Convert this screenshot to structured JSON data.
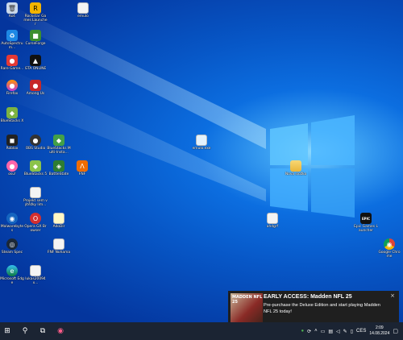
{
  "desktop_icons": [
    {
      "label": "Koš",
      "glyph": "🗑"
    },
    {
      "label": "Rockstar Games Launcher",
      "glyph": "R"
    },
    {
      "label": "emulo",
      "glyph": ""
    },
    {
      "label": "AutoSpectrum...",
      "glyph": "♻"
    },
    {
      "label": "CurseForge",
      "glyph": "■"
    },
    {
      "label": "Rare Game...",
      "glyph": "●"
    },
    {
      "label": "GTA ONLINE",
      "glyph": "▲"
    },
    {
      "label": "Firefox",
      "glyph": "●"
    },
    {
      "label": "Among Us",
      "glyph": "●"
    },
    {
      "label": "BlueStacks X",
      "glyph": "◆"
    },
    {
      "label": "Roblox",
      "glyph": "◼"
    },
    {
      "label": "OBS Studio",
      "glyph": "●"
    },
    {
      "label": "BlueStacks Multi-Insta...",
      "glyph": "◆"
    },
    {
      "label": "emulo.exe",
      "glyph": ""
    },
    {
      "label": "Nová složka",
      "glyph": ""
    },
    {
      "label": "osu!",
      "glyph": "●"
    },
    {
      "label": "BlueStacks 5",
      "glyph": "◆"
    },
    {
      "label": "BattleState",
      "glyph": "◈"
    },
    {
      "label": "FNF",
      "glyph": "Λ"
    },
    {
      "label": "Projekt sem výtěžky lim...",
      "glyph": ""
    },
    {
      "label": "Malwarebytes",
      "glyph": "◉"
    },
    {
      "label": "Opera GX Browser",
      "glyph": "O"
    },
    {
      "label": "AdoDir",
      "glyph": ""
    },
    {
      "label": "ahdgrf",
      "glyph": ""
    },
    {
      "label": "Epic Games Launcher",
      "glyph": "EPIC"
    },
    {
      "label": "Steam Spec",
      "glyph": "◎"
    },
    {
      "label": "FNF Nohama",
      "glyph": ""
    },
    {
      "label": "Google Chrome",
      "glyph": "◉"
    },
    {
      "label": "Microsoft Edge",
      "glyph": "e"
    },
    {
      "label": "lukas20094x...",
      "glyph": ""
    }
  ],
  "toast": {
    "thumb_text": "MADDEN NFL 25",
    "title": "EARLY ACCESS: Madden NFL 25",
    "body": "Pre-purchase the Deluxe Edition and start playing Madden NFL 25 today!",
    "close": "×"
  },
  "taskbar": {
    "start": "⊞",
    "search": "⚲",
    "task_view": "⧉",
    "pinned_app": "◉",
    "language": "CES",
    "time": "2:09",
    "date": "14.08.2024"
  },
  "colors": {
    "accent": "#0078d7",
    "taskbar": "#1b2433",
    "toast": "#1f1f1f"
  }
}
